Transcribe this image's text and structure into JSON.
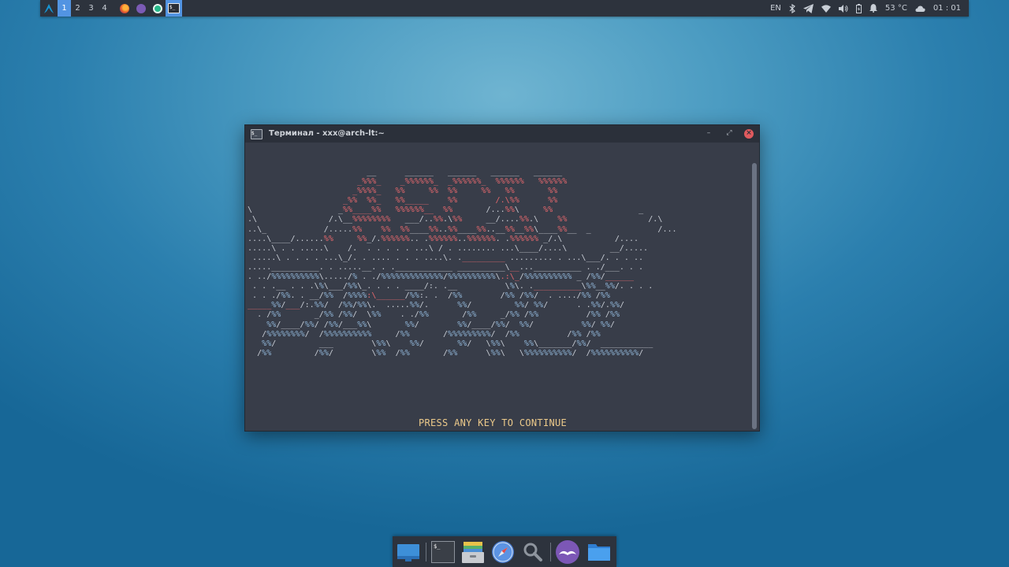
{
  "top_panel": {
    "workspaces": [
      "1",
      "2",
      "3",
      "4"
    ],
    "active_workspace": "1",
    "launchers": [
      "firefox-icon",
      "cantata-icon",
      "cloud-sync-icon",
      "terminal-icon"
    ],
    "keyboard_layout": "EN",
    "temperature": "53 °C",
    "clock": "01 : 01"
  },
  "terminal": {
    "title": "Терминал - xxx@arch-lt:~",
    "icon_label": "$_",
    "prompt": "PRESS ANY KEY TO CONTINUE"
  },
  "dock": {
    "items": [
      "show-desktop",
      "terminal",
      "archive-manager",
      "web-browser",
      "search",
      "cantata",
      "file-manager"
    ]
  },
  "colors": {
    "accent": "#5294e2",
    "panel": "#2d333d",
    "terminal_bg": "#383d49",
    "ascii_red": "#e3676c",
    "ascii_blue": "#7c8da5",
    "prompt_yellow": "#ebc98a"
  }
}
